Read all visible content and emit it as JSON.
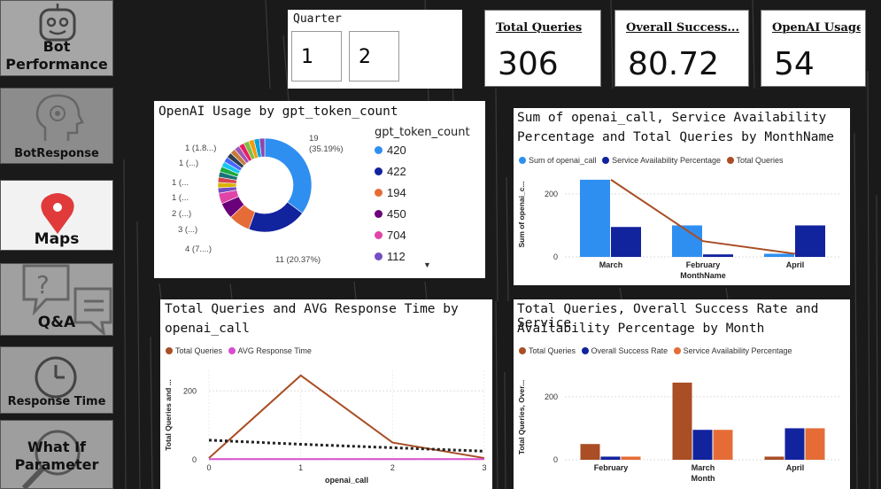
{
  "nav": [
    {
      "label_lines": [
        "Bot",
        "Performance"
      ]
    },
    {
      "label_lines": [
        "BotResponse"
      ]
    },
    {
      "label_lines": [
        "Maps"
      ]
    },
    {
      "label_lines": [
        "Q&A"
      ]
    },
    {
      "label_lines": [
        "Response Time"
      ]
    },
    {
      "label_lines": [
        "What If",
        "Parameter"
      ]
    }
  ],
  "slicer": {
    "title": "Quarter",
    "options": [
      "1",
      "2"
    ]
  },
  "kpis": [
    {
      "title": "Total Queries",
      "value": "306"
    },
    {
      "title": "Overall Success...",
      "value": "80.72"
    },
    {
      "title": "OpenAI Usage",
      "value": "54"
    }
  ],
  "colors": {
    "blue": "#2f8ff0",
    "navy": "#12239e",
    "orange": "#e66c37",
    "purple": "#6b007b",
    "pink": "#e044a7",
    "violet": "#744ec2",
    "rust": "#a94e25",
    "magenta": "#d64ecf"
  },
  "donut": {
    "title": "OpenAI Usage by gpt_token_count",
    "legend_title": "gpt_token_count",
    "legend_items": [
      "420",
      "422",
      "194",
      "450",
      "704",
      "112"
    ],
    "labels": [
      "19\n(35.19%)",
      "11 (20.37%)",
      "4 (7....)",
      "3 (...)",
      "2 (...)",
      "1 (...",
      "1 (...",
      "1 (...)",
      "1 (1.8...)"
    ],
    "chart_data": {
      "type": "pie",
      "slices": [
        {
          "label": "420",
          "value": 19
        },
        {
          "label": "422",
          "value": 11
        },
        {
          "label": "194",
          "value": 4
        },
        {
          "label": "450",
          "value": 3
        },
        {
          "label": "704",
          "value": 2
        },
        {
          "label": "112",
          "value": 1
        },
        {
          "label": "",
          "value": 1
        },
        {
          "label": "",
          "value": 1
        },
        {
          "label": "",
          "value": 1
        },
        {
          "label": "",
          "value": 1
        },
        {
          "label": "",
          "value": 1
        },
        {
          "label": "",
          "value": 1
        },
        {
          "label": "",
          "value": 1
        },
        {
          "label": "",
          "value": 1
        },
        {
          "label": "",
          "value": 1
        },
        {
          "label": "",
          "value": 1
        },
        {
          "label": "",
          "value": 1
        },
        {
          "label": "",
          "value": 1
        },
        {
          "label": "",
          "value": 1
        },
        {
          "label": "",
          "value": 1
        }
      ]
    }
  },
  "chart_month": {
    "title_lines": [
      "Sum of openai_call, Service Availability",
      "Percentage and Total Queries by MonthName"
    ],
    "legend": [
      "Sum of openai_call",
      "Service Availability Percentage",
      "Total Queries"
    ],
    "xlabel": "MonthName",
    "ylabel": "Sum of openai_c...",
    "chart_data": {
      "type": "bar",
      "categories": [
        "March",
        "February",
        "April"
      ],
      "series": [
        {
          "name": "Sum of openai_call",
          "kind": "bar",
          "values": [
            245,
            100,
            10
          ]
        },
        {
          "name": "Service Availability Percentage",
          "kind": "bar",
          "values": [
            95,
            8,
            100
          ]
        },
        {
          "name": "Total Queries",
          "kind": "line",
          "values": [
            245,
            50,
            10
          ]
        }
      ],
      "ylim": [
        0,
        270
      ],
      "yticks": [
        0,
        200
      ]
    }
  },
  "chart_response": {
    "title_lines": [
      "Total Queries and AVG Response Time by",
      "openai_call"
    ],
    "legend": [
      "Total Queries",
      "AVG Response Time"
    ],
    "xlabel": "openai_call",
    "ylabel": "Total Queries and ...",
    "chart_data": {
      "type": "line",
      "x": [
        0,
        1,
        2,
        3
      ],
      "series": [
        {
          "name": "Total Queries",
          "values": [
            5,
            245,
            50,
            5
          ]
        },
        {
          "name": "AVG Response Time",
          "values": [
            2,
            2,
            2,
            2
          ]
        },
        {
          "name": "",
          "style": "dotted",
          "values": [
            57,
            45,
            35,
            25
          ]
        }
      ],
      "xlim": [
        0,
        3
      ],
      "ylim": [
        0,
        260
      ],
      "yticks": [
        0,
        200
      ]
    }
  },
  "chart_success": {
    "title_lines": [
      "Total Queries, Overall Success Rate and Service",
      "Availability Percentage by Month"
    ],
    "legend": [
      "Total Queries",
      "Overall Success Rate",
      "Service Availability Percentage"
    ],
    "xlabel": "Month",
    "ylabel": "Total Queries, Over...",
    "chart_data": {
      "type": "bar",
      "categories": [
        "February",
        "March",
        "April"
      ],
      "series": [
        {
          "name": "Total Queries",
          "values": [
            50,
            245,
            10
          ]
        },
        {
          "name": "Overall Success Rate",
          "values": [
            10,
            95,
            100
          ]
        },
        {
          "name": "Service Availability Percentage",
          "values": [
            10,
            95,
            100
          ]
        }
      ],
      "ylim": [
        0,
        270
      ],
      "yticks": [
        0,
        200
      ]
    }
  }
}
